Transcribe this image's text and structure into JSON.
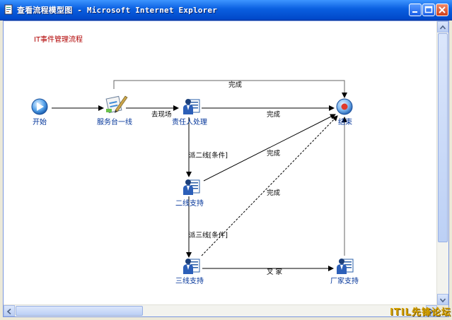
{
  "window": {
    "title": "查看流程模型图 - Microsoft Internet Explorer"
  },
  "diagram": {
    "title": "IT事件管理流程",
    "nodes": {
      "start": "开始",
      "service_desk": "服务台一线",
      "owner": "责任人处理",
      "second_line": "二线支持",
      "third_line": "三线支持",
      "vendor": "厂家支持",
      "end": "结束"
    },
    "edges": {
      "top_complete": "完成",
      "onsite": "去现场",
      "owner_complete": "完成",
      "dispatch_second": "派二线[条件]",
      "second_complete": "完成",
      "dispatch_third": "派三线[条件]",
      "third_complete": "完成",
      "third_vendor": "叉 家"
    }
  },
  "watermark": "ITIL先锋论坛",
  "colors": {
    "titlebar": "#0a5fe0",
    "node_label": "#003399",
    "diagram_title": "#b00000"
  }
}
